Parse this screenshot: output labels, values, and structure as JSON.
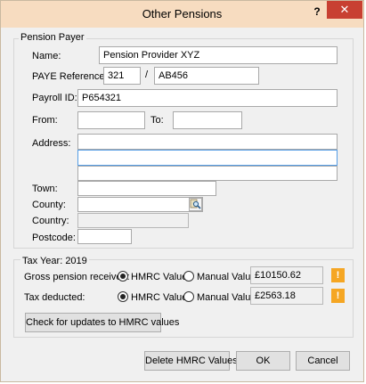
{
  "window": {
    "title": "Other Pensions",
    "help": "?",
    "close": "✕"
  },
  "payer": {
    "legend": "Pension Payer",
    "name_label": "Name:",
    "name_value": "Pension Provider XYZ",
    "paye_label": "PAYE Reference:",
    "paye_part1": "321",
    "paye_sep": "/",
    "paye_part2": "AB456",
    "payroll_label": "Payroll ID:",
    "payroll_value": "P654321",
    "from_label": "From:",
    "from_value": "",
    "to_label": "To:",
    "to_value": "",
    "address_label": "Address:",
    "address_lines": [
      "",
      "",
      ""
    ],
    "town_label": "Town:",
    "town_value": "",
    "county_label": "County:",
    "county_value": "",
    "country_label": "Country:",
    "country_value": "",
    "postcode_label": "Postcode:",
    "postcode_value": ""
  },
  "tax": {
    "legend": "Tax Year: 2019",
    "gross_label": "Gross pension received:",
    "gross_hmrc": "HMRC Value",
    "gross_manual": "Manual Value",
    "gross_value": "£10150.62",
    "deducted_label": "Tax deducted:",
    "deducted_hmrc": "HMRC Value",
    "deducted_manual": "Manual Value",
    "deducted_value": "£2563.18",
    "warn": "!",
    "check_button": "Check for updates to HMRC values"
  },
  "footer": {
    "delete": "Delete HMRC Values",
    "ok": "OK",
    "cancel": "Cancel"
  },
  "colors": {
    "titlebar": "#f7dcc0",
    "close": "#c84032",
    "warning": "#f5a623",
    "focus": "#569de5"
  }
}
